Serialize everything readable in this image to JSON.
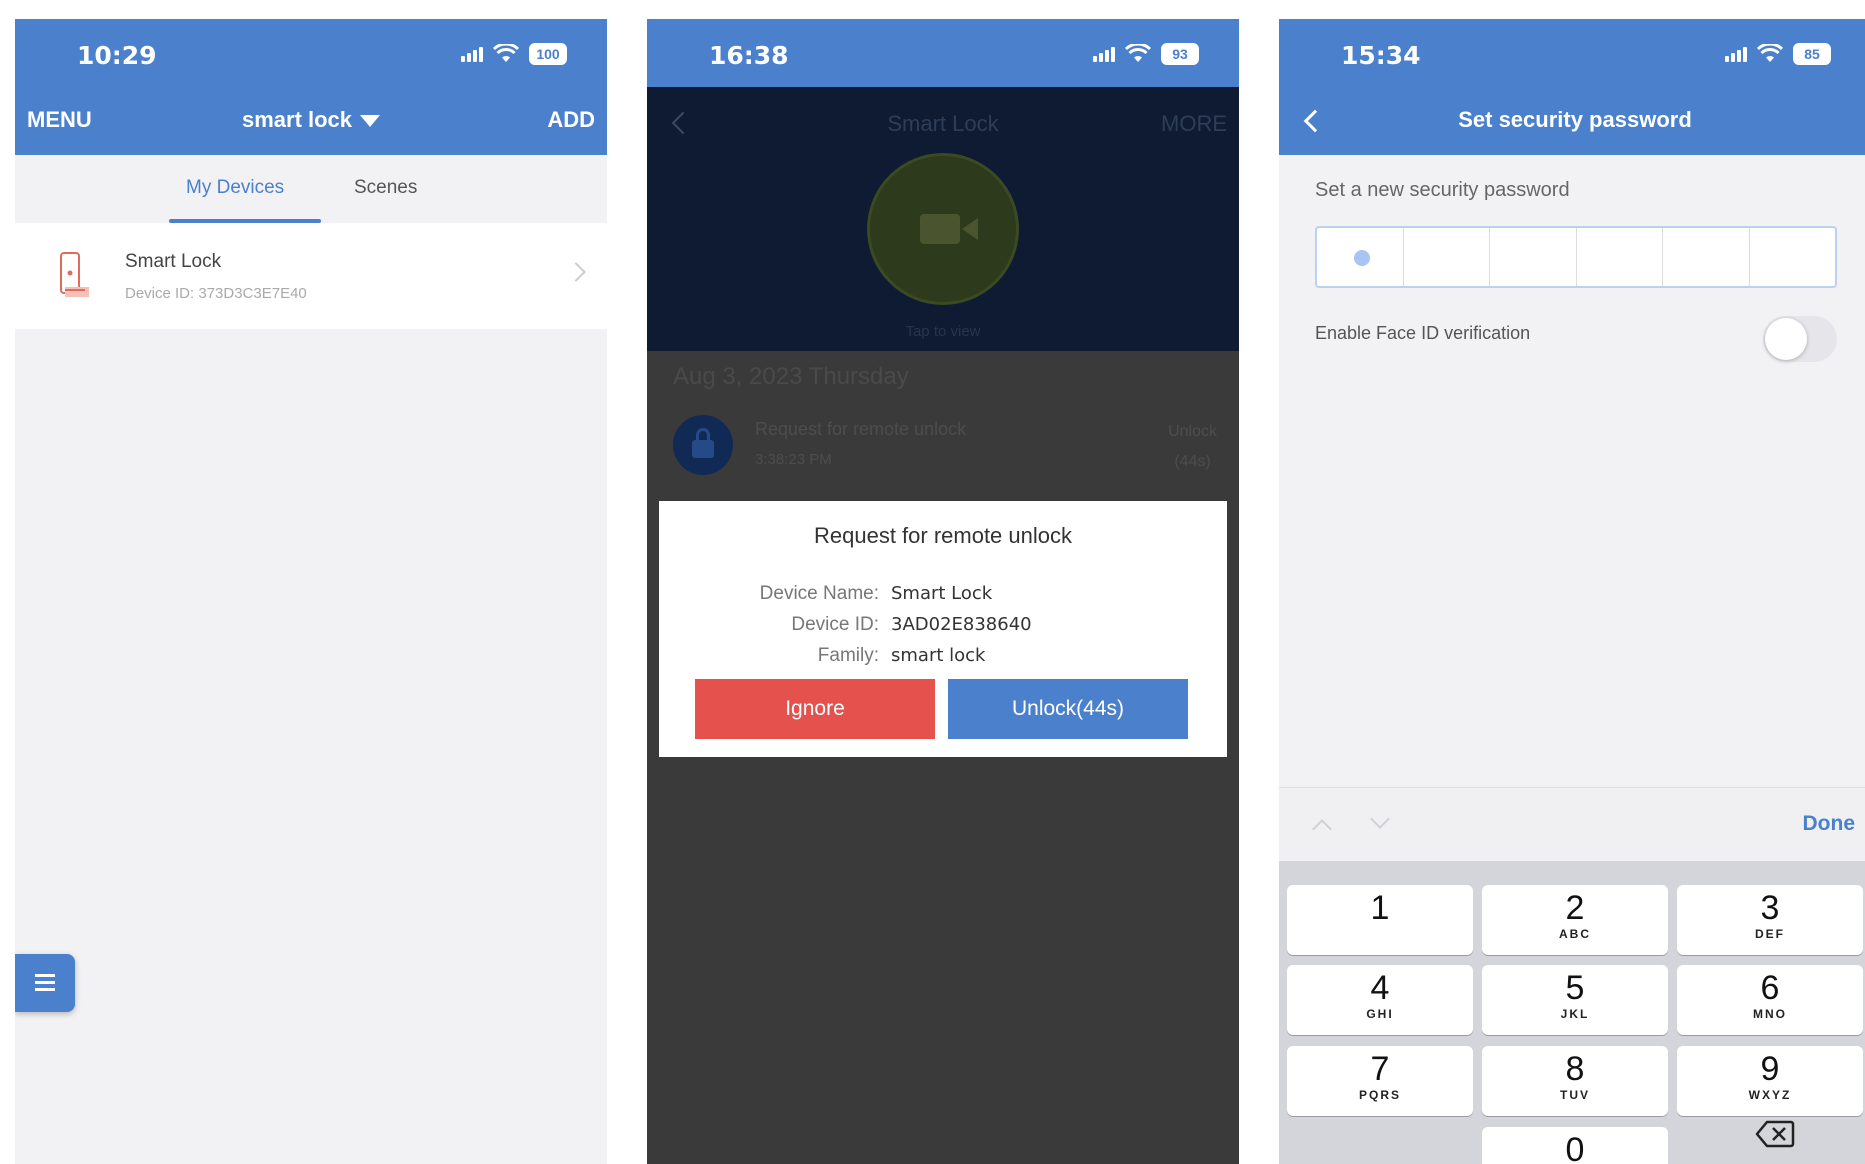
{
  "phone1": {
    "status": {
      "time": "10:29",
      "battery": "100"
    },
    "nav": {
      "left": "MENU",
      "center": "smart lock",
      "right": "ADD"
    },
    "tabs": [
      {
        "label": "My Devices"
      },
      {
        "label": "Scenes"
      }
    ],
    "device": {
      "name": "Smart Lock",
      "id": "Device ID: 373D3C3E7E40"
    }
  },
  "phone2": {
    "status": {
      "time": "16:38",
      "battery": "93"
    },
    "nav": {
      "title": "Smart Lock",
      "right": "MORE"
    },
    "camera": {
      "hint": "Tap to view"
    },
    "date": "Aug 3, 2023 Thursday",
    "log": {
      "title": "Request for remote unlock",
      "time": "3:38:23 PM",
      "status_line1": "Unlock",
      "status_line2": "(44s)"
    },
    "dialog": {
      "title": "Request for remote unlock",
      "rows": [
        {
          "key": "Device Name:",
          "value": "Smart Lock"
        },
        {
          "key": "Device ID:",
          "value": "3AD02E838640"
        },
        {
          "key": "Family:",
          "value": "smart lock"
        }
      ],
      "ignore_label": "Ignore",
      "unlock_label": "Unlock(44s)"
    }
  },
  "phone3": {
    "status": {
      "time": "15:34",
      "battery": "85"
    },
    "nav": {
      "title": "Set security password"
    },
    "label": "Set a new security password",
    "face_id_label": "Enable Face ID verification",
    "face_id_enabled": false,
    "done_label": "Done",
    "keys": [
      {
        "num": "1",
        "letters": ""
      },
      {
        "num": "2",
        "letters": "ABC"
      },
      {
        "num": "3",
        "letters": "DEF"
      },
      {
        "num": "4",
        "letters": "GHI"
      },
      {
        "num": "5",
        "letters": "JKL"
      },
      {
        "num": "6",
        "letters": "MNO"
      },
      {
        "num": "7",
        "letters": "PQRS"
      },
      {
        "num": "8",
        "letters": "TUV"
      },
      {
        "num": "9",
        "letters": "WXYZ"
      },
      {
        "num": "0",
        "letters": ""
      }
    ]
  },
  "colors": {
    "accent": "#4a80cc",
    "danger": "#e5514d",
    "background": "#f2f2f5"
  }
}
